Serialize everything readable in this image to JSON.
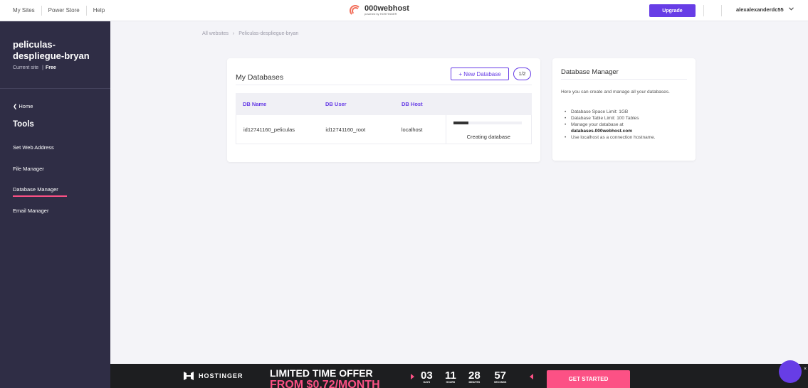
{
  "topnav": {
    "items": [
      "My Sites",
      "Power Store",
      "Help"
    ]
  },
  "logo": {
    "name": "000webhost",
    "tagline": "powered by HOSTINGER"
  },
  "header": {
    "upgrade_label": "Upgrade",
    "bell_icon": "bell-icon",
    "username": "alexalexanderdc55",
    "chevron": "⌄"
  },
  "sidebar": {
    "site_name": "peliculas-despliegue-bryan",
    "current_site_label": "Current site",
    "plan": "Free",
    "home_label": "Home",
    "tools_title": "Tools",
    "items": [
      {
        "label": "Set Web Address",
        "active": false
      },
      {
        "label": "File Manager",
        "active": false
      },
      {
        "label": "Database Manager",
        "active": true
      },
      {
        "label": "Email Manager",
        "active": false
      }
    ]
  },
  "breadcrumb": {
    "root": "All websites",
    "separator": "›",
    "current": "Peliculas-despliegue-bryan"
  },
  "databases": {
    "title": "My Databases",
    "new_button": "+ New Database",
    "count": "1/2",
    "columns": [
      "DB Name",
      "DB User",
      "DB Host",
      ""
    ],
    "rows": [
      {
        "name": "id12741160_peliculas",
        "user": "id12741160_root",
        "host": "localhost",
        "progress": 0.22,
        "status": "Creating database"
      }
    ]
  },
  "info": {
    "title": "Database Manager",
    "description": "Here you can create and manage all your databases.",
    "bullets": [
      "Database Space Limit: 1GB",
      "Database Table Limit: 100 Tables",
      "Manage your database at",
      "Use localhost as a connection hostname."
    ],
    "manage_url": "databases.000webhost.com"
  },
  "promo": {
    "brand": "HOSTINGER",
    "offer_line1": "LIMITED TIME OFFER",
    "offer_line2": "FROM $0.72/MONTH",
    "countdown": [
      {
        "value": "03",
        "unit": "DAYS"
      },
      {
        "value": "11",
        "unit": "HOURS"
      },
      {
        "value": "28",
        "unit": "MINUTES"
      },
      {
        "value": "57",
        "unit": "SECONDS"
      }
    ],
    "cta": "GET STARTED",
    "close": "×"
  },
  "colors": {
    "accent": "#673de6",
    "sidebar_bg": "#2f2d45",
    "highlight": "#fc5185",
    "banner_bg": "#1d1e20"
  }
}
